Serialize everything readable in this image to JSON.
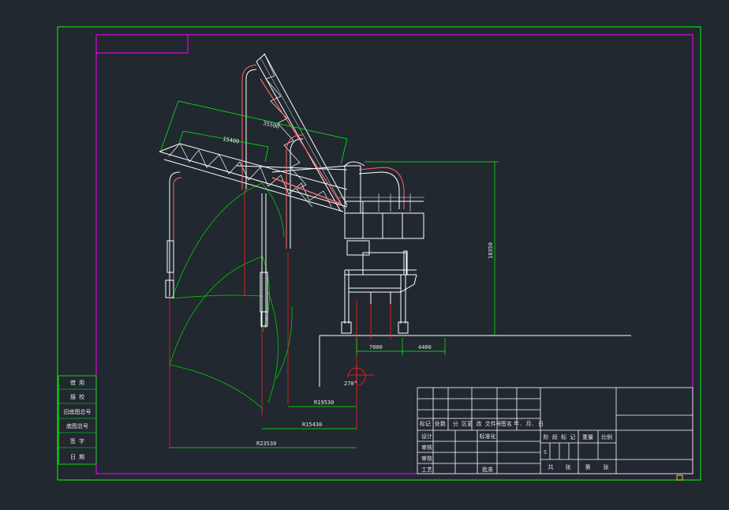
{
  "colors": {
    "background": "#212830",
    "border": "#00ff00",
    "inner_frame": "#ff00ff",
    "structure": "#ffffff",
    "hidden": "#ff2020",
    "pipe": "#ff6666",
    "dimension": "#00ff00"
  },
  "dimensions": {
    "boom_length": "35500",
    "arm_length": "15400",
    "height": "18350",
    "track_gauge": "7000",
    "track_offset": "4400",
    "rotation_angle": "270°",
    "reach_1": "R19530",
    "reach_2": "R15430",
    "reach_3": "R23530"
  },
  "side_table": {
    "rows": [
      "借 用",
      "描 校",
      "旧底图总号",
      "底图总号",
      "签 字",
      "日 期"
    ]
  },
  "title_block": {
    "header_row": [
      "标记",
      "处数",
      "分 区",
      "更 改 文件号",
      "签名",
      "年. 月. 日"
    ],
    "rows": [
      {
        "label": "设计",
        "mid": "标准化"
      },
      {
        "label": "审核",
        "mid": ""
      },
      {
        "label": "审核",
        "mid": ""
      },
      {
        "label": "工艺",
        "mid": "批准"
      }
    ],
    "stage_row": [
      "阶 段 标 记",
      "重量",
      "比例"
    ],
    "sheet_row": [
      "共",
      "张",
      "第",
      "张"
    ],
    "stage_mark": "S"
  }
}
